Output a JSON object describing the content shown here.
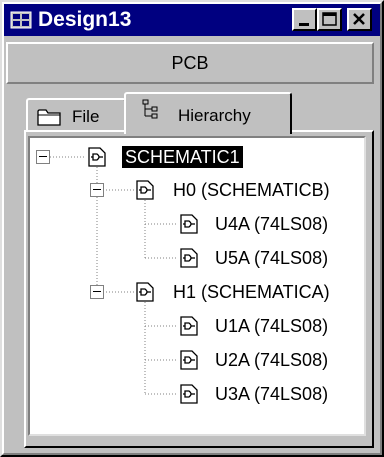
{
  "window": {
    "title": "Design13",
    "title_bar_color": "#000080",
    "icons": {
      "app": "design-manager-icon",
      "minimize": "minimize-icon",
      "maximize": "maximize-icon",
      "close": "close-icon"
    }
  },
  "toolbar": {
    "pcb_label": "PCB"
  },
  "tabs": [
    {
      "label": "File",
      "icon": "folder-icon",
      "active": false
    },
    {
      "label": "Hierarchy",
      "icon": "hierarchy-icon",
      "active": true
    }
  ],
  "tree": {
    "selected_color": "#000000",
    "nodes": [
      {
        "label": "SCHEMATIC1",
        "level": 0,
        "expander": "minus",
        "selected": true
      },
      {
        "label": "H0 (SCHEMATICB)",
        "level": 1,
        "expander": "minus",
        "selected": false
      },
      {
        "label": "U4A (74LS08)",
        "level": 2,
        "expander": "none",
        "selected": false
      },
      {
        "label": "U5A (74LS08)",
        "level": 2,
        "expander": "none",
        "selected": false
      },
      {
        "label": "H1 (SCHEMATICA)",
        "level": 1,
        "expander": "minus",
        "selected": false
      },
      {
        "label": "U1A (74LS08)",
        "level": 2,
        "expander": "none",
        "selected": false
      },
      {
        "label": "U2A (74LS08)",
        "level": 2,
        "expander": "none",
        "selected": false
      },
      {
        "label": "U3A (74LS08)",
        "level": 2,
        "expander": "none",
        "selected": false
      }
    ]
  }
}
